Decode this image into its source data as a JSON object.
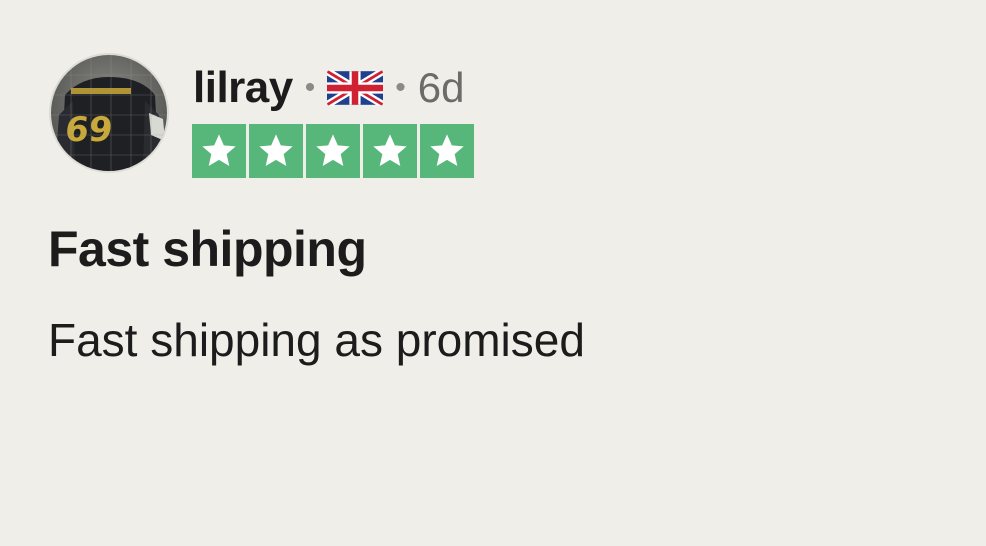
{
  "review": {
    "username": "lilray",
    "separator": "•",
    "country_flag": "uk-flag-icon",
    "date": "6d",
    "rating": {
      "stars": 5,
      "max": 5,
      "star_color": "#57b77a"
    },
    "title": "Fast shipping",
    "body": "Fast shipping as promised"
  },
  "colors": {
    "background": "#efeee9",
    "text": "#1c1c1c",
    "muted": "#6b6b67",
    "star_green": "#57b77a"
  }
}
